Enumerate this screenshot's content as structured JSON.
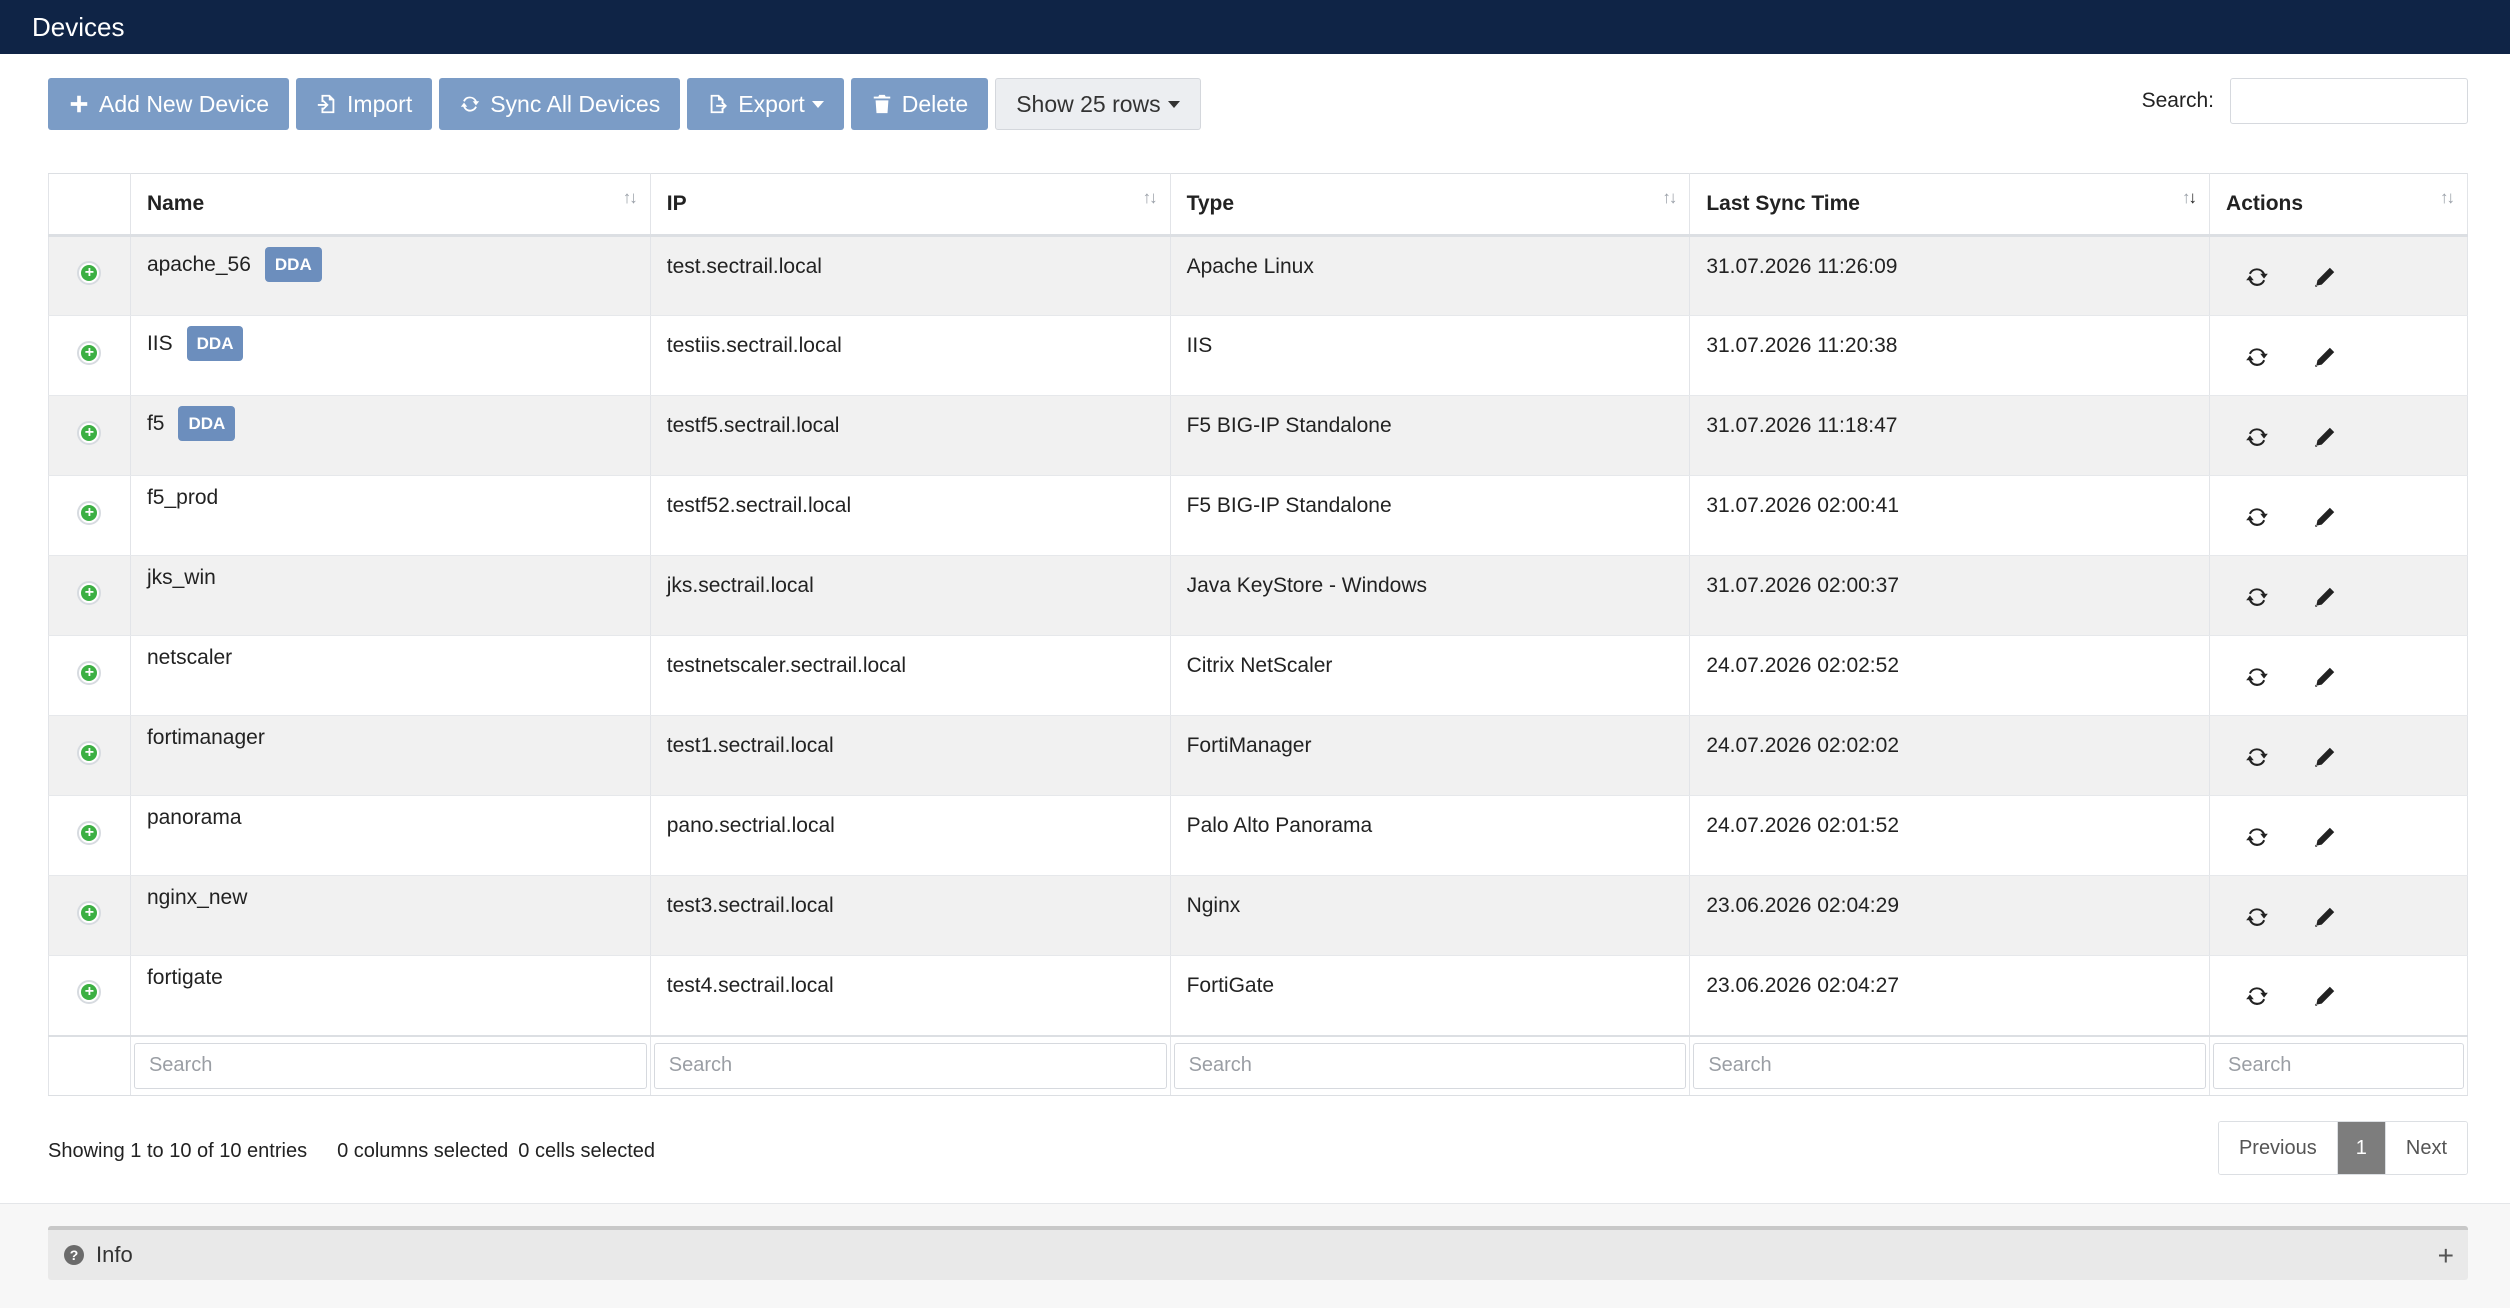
{
  "header": {
    "title": "Devices"
  },
  "toolbar": {
    "add_label": "Add New Device",
    "import_label": "Import",
    "sync_label": "Sync All Devices",
    "export_label": "Export",
    "delete_label": "Delete",
    "rows_label": "Show 25 rows",
    "search_label": "Search:",
    "search_value": ""
  },
  "table": {
    "columns": [
      "Name",
      "IP",
      "Type",
      "Last Sync Time",
      "Actions"
    ],
    "rows": [
      {
        "name": "apache_56",
        "badge": "DDA",
        "ip": "test.sectrail.local",
        "type": "Apache Linux",
        "last_sync": "31.07.2026 11:26:09"
      },
      {
        "name": "IIS",
        "badge": "DDA",
        "ip": "testiis.sectrail.local",
        "type": "IIS",
        "last_sync": "31.07.2026 11:20:38"
      },
      {
        "name": "f5",
        "badge": "DDA",
        "ip": "testf5.sectrail.local",
        "type": "F5 BIG-IP Standalone",
        "last_sync": "31.07.2026 11:18:47"
      },
      {
        "name": "f5_prod",
        "badge": "",
        "ip": "testf52.sectrail.local",
        "type": "F5 BIG-IP Standalone",
        "last_sync": "31.07.2026 02:00:41"
      },
      {
        "name": "jks_win",
        "badge": "",
        "ip": "jks.sectrail.local",
        "type": "Java KeyStore - Windows",
        "last_sync": "31.07.2026 02:00:37"
      },
      {
        "name": "netscaler",
        "badge": "",
        "ip": "testnetscaler.sectrail.local",
        "type": "Citrix NetScaler",
        "last_sync": "24.07.2026 02:02:52"
      },
      {
        "name": "fortimanager",
        "badge": "",
        "ip": "test1.sectrail.local",
        "type": "FortiManager",
        "last_sync": "24.07.2026 02:02:02"
      },
      {
        "name": "panorama",
        "badge": "",
        "ip": "pano.sectrial.local",
        "type": "Palo Alto Panorama",
        "last_sync": "24.07.2026 02:01:52"
      },
      {
        "name": "nginx_new",
        "badge": "",
        "ip": "test3.sectrail.local",
        "type": "Nginx",
        "last_sync": "23.06.2026 02:04:29"
      },
      {
        "name": "fortigate",
        "badge": "",
        "ip": "test4.sectrail.local",
        "type": "FortiGate",
        "last_sync": "23.06.2026 02:04:27"
      }
    ],
    "footer_search_placeholder": "Search"
  },
  "status": {
    "showing": "Showing 1 to 10 of 10 entries",
    "columns_selected": "0 columns selected",
    "cells_selected": "0 cells selected"
  },
  "pagination": {
    "previous": "Previous",
    "current": "1",
    "next": "Next"
  },
  "info_panel": {
    "label": "Info"
  },
  "icons": {
    "add": "plus-icon",
    "import": "file-import-icon",
    "sync": "sync-icon",
    "export": "file-export-icon",
    "delete": "trash-icon",
    "expand": "plus-circle-icon",
    "edit": "pencil-icon",
    "info": "question-circle-icon"
  },
  "colors": {
    "header_bg": "#0f2446",
    "button_bg": "#7b9cc6",
    "badge_bg": "#6c8ebd",
    "expand_green": "#3cb043",
    "pager_active": "#7d7d7d"
  }
}
